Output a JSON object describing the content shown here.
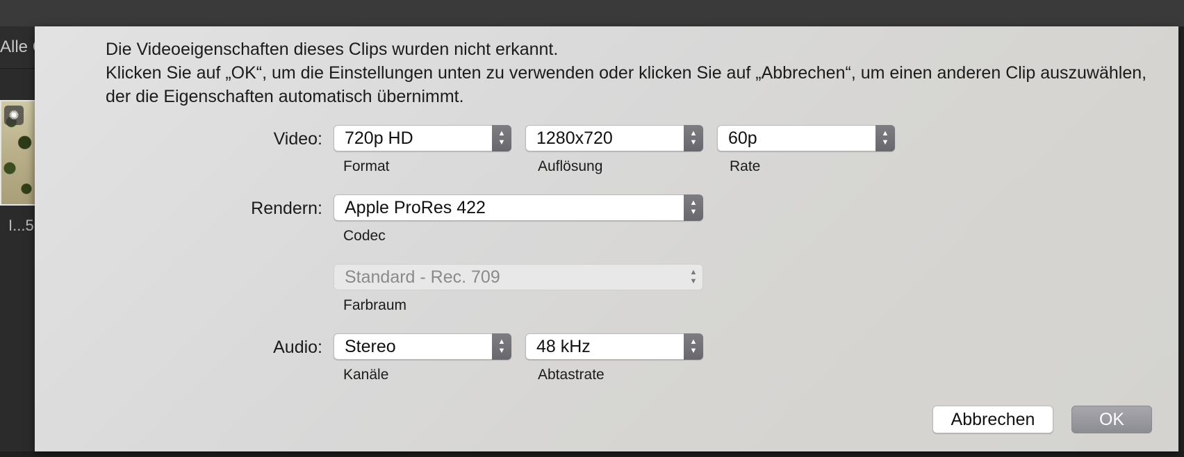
{
  "background": {
    "tab_label": "Alle C",
    "thumb_label": "I...5"
  },
  "dialog": {
    "message_line1": "Die Videoeigenschaften dieses Clips wurden nicht erkannt.",
    "message_line2": "Klicken Sie auf „OK“, um die Einstellungen unten zu verwenden oder klicken Sie auf „Abbrechen“, um einen anderen Clip auszuwählen, der die Eigenschaften automatisch übernimmt.",
    "video": {
      "label": "Video:",
      "format": {
        "value": "720p HD",
        "caption": "Format"
      },
      "resolution": {
        "value": "1280x720",
        "caption": "Auflösung"
      },
      "rate": {
        "value": "60p",
        "caption": "Rate"
      }
    },
    "render": {
      "label": "Rendern:",
      "codec": {
        "value": "Apple ProRes 422",
        "caption": "Codec"
      },
      "colorspace": {
        "value": "Standard - Rec. 709",
        "caption": "Farbraum",
        "enabled": false
      }
    },
    "audio": {
      "label": "Audio:",
      "channels": {
        "value": "Stereo",
        "caption": "Kanäle"
      },
      "samplerate": {
        "value": "48 kHz",
        "caption": "Abtastrate"
      }
    },
    "buttons": {
      "cancel": "Abbrechen",
      "ok": "OK"
    }
  },
  "icons": {
    "popup_arrows": "chevron-up-down-icon",
    "loading": "spinner-icon"
  }
}
